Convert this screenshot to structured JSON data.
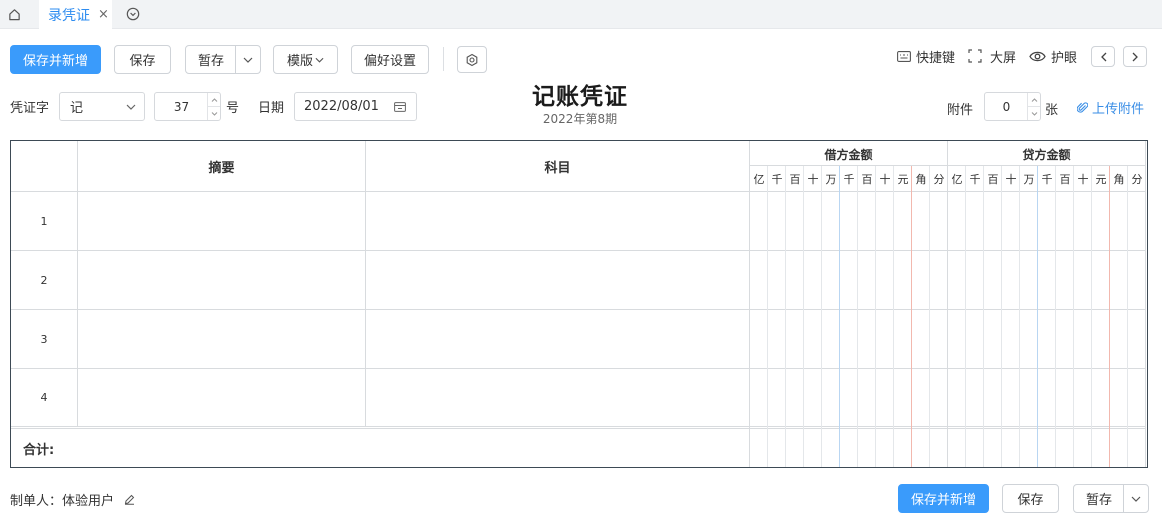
{
  "tabs": {
    "home_icon": "home-icon",
    "active_label": "录凭证",
    "close_glyph": "×",
    "more_icon": "chevron-circle-down-icon"
  },
  "toolbar": {
    "save_new": "保存并新增",
    "save": "保存",
    "draft": "暂存",
    "template": "模版",
    "preferences": "偏好设置",
    "settings_icon": "settings-icon",
    "shortcuts": "快捷键",
    "fullscreen": "大屏",
    "eye_care": "护眼"
  },
  "form": {
    "voucher_word_label": "凭证字",
    "voucher_word_value": "记",
    "voucher_number": "37",
    "number_suffix": "号",
    "date_label": "日期",
    "date_value": "2022/08/01",
    "attachment_label": "附件",
    "attachment_count": "0",
    "attachment_unit": "张",
    "upload_label": "上传附件"
  },
  "voucher": {
    "title": "记账凭证",
    "period": "2022年第8期",
    "col_summary": "摘要",
    "col_account": "科目",
    "debit_header": "借方金额",
    "credit_header": "贷方金额",
    "digits": [
      "亿",
      "千",
      "百",
      "十",
      "万",
      "千",
      "百",
      "十",
      "元",
      "角",
      "分"
    ],
    "rows": [
      "1",
      "2",
      "3",
      "4"
    ],
    "total_label": "合计:"
  },
  "footer": {
    "maker_label": "制单人：体验用户",
    "save_new": "保存并新增",
    "save": "保存",
    "draft": "暂存"
  },
  "colors": {
    "primary": "#3a9bfb",
    "link": "#3a8ee6",
    "yuan_line": "#f2b8ae",
    "wan_line": "#b9d6f2"
  }
}
